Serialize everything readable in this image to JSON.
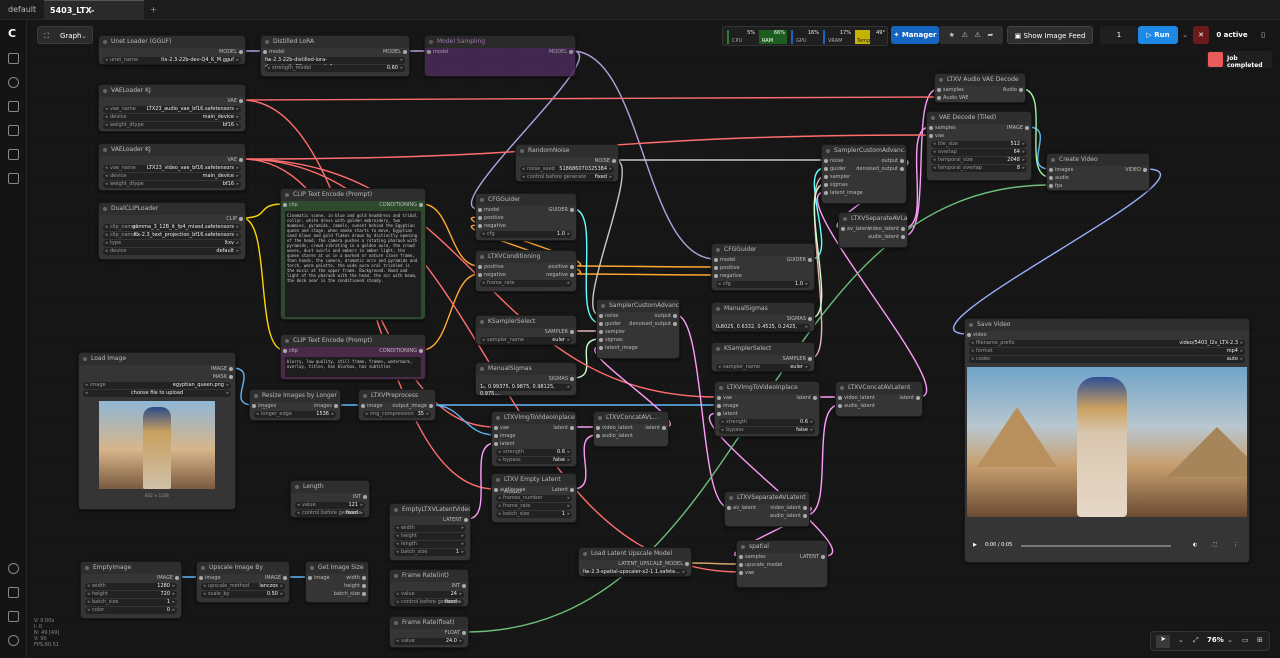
{
  "tabs": [
    {
      "label": "default"
    },
    {
      "label": "5403_LTX-2.3_I2V_...",
      "active": true
    }
  ],
  "toolbar": {
    "graph_label": "Graph",
    "cpu_label": "CPU",
    "cpu_val": "5%",
    "ram_label": "RAM",
    "ram_val": "66%",
    "gpu_label": "GPU",
    "gpu_val": "16%",
    "vram_label": "VRAM",
    "vram_val": "17%",
    "temp_label": "Temp",
    "temp_val": "49°",
    "manager": "Manager",
    "feed": "Show Image Feed",
    "queue_count": "1",
    "run": "Run",
    "active": "0 active",
    "job": "Job completed"
  },
  "zoom": "76%",
  "stats": [
    "V: 0.00x",
    "I: 0",
    "N: 49 [49]",
    "V: 90",
    "FPS:60.51"
  ],
  "nodes": {
    "unet": {
      "title": "Unet Loader (GGUF)",
      "badge": "GGUF",
      "out": "MODEL",
      "w": [
        [
          "unet_name",
          "ltx-2.3-22b-dev-Q4_K_M.gguf"
        ]
      ]
    },
    "lora": {
      "title": "Distilled LoRA",
      "in": "model",
      "out": "MODEL",
      "w": [
        [
          "",
          "ltx-2.3-22b-distilled-lora-dynamic_fro09_avg_rank_1..."
        ],
        [
          "strength_model",
          "0.60"
        ]
      ]
    },
    "bypass": {
      "title": "Model Sampling",
      "in": "model",
      "out": "MODEL"
    },
    "vae1": {
      "title": "VAELoader KJ",
      "badge": "comfyui-kjnodes",
      "out": "VAE",
      "w": [
        [
          "vae_name",
          "LTX23_audio_vae_bf16.safetensors"
        ],
        [
          "device",
          "main_device"
        ],
        [
          "weight_dtype",
          "bf16"
        ]
      ]
    },
    "vae2": {
      "title": "VAELoader KJ",
      "badge": "comfyui-kjnodes",
      "out": "VAE",
      "w": [
        [
          "vae_name",
          "LTX23_video_vae_bf16.safetensors"
        ],
        [
          "device",
          "main_device"
        ],
        [
          "weight_dtype",
          "bf16"
        ]
      ]
    },
    "clip": {
      "title": "DualCLIPLoader",
      "out": "CLIP",
      "w": [
        [
          "clip_name1",
          "gemma_3_12B_it_fp4_mixed.safetensors"
        ],
        [
          "clip_name2",
          "ltx-2.3_text_projection_bf16.safetensors"
        ],
        [
          "type",
          "ltxv"
        ],
        [
          "device",
          "default"
        ]
      ]
    },
    "pos": {
      "title": "CLIP Text Encode (Prompt)",
      "in": "clip",
      "out": "CONDITIONING",
      "text": "Cinematic scene, in blue and gold headdress and tribal collar, white dress with golden embroidery, two mummies, pyramids, camels, sunset behind the Egyptian queen and stage, when smoke starts to move, Egyptian sand blows and gold flakes drawn by distinctly opening of the head, the camera pushes a rotating pharaoh with pyramids, crowd vibrating in a golden aura, the crowd waves, dust swirls and embers in amber light, the queen stares at us in a marked or nature close frame, then hands, the camera, dramatic arcs and pyramids and torch, warm palette, the wide aura oral trickled is the music at the upper frame. Background. Hand and light of the pharaoh with the head, the air with beam, the deck near is the conditioned steady."
    },
    "neg": {
      "title": "CLIP Text Encode (Prompt)",
      "in": "clip",
      "out": "CONDITIONING",
      "text": "blurry, low quality, still frame, frames, watermark, overlay, titles, has blurbox, has subtitles"
    },
    "noise": {
      "title": "RandomNoise",
      "out": "NOISE",
      "w": [
        [
          "noise_seed",
          "518686070325384"
        ],
        [
          "control before generate",
          "fixed"
        ]
      ]
    },
    "cfg1": {
      "title": "CFGGuider",
      "ins": [
        "model",
        "positive",
        "negative"
      ],
      "out": "GUIDER",
      "w": [
        [
          "cfg",
          "1.0"
        ]
      ]
    },
    "ltxcond": {
      "title": "LTXVConditioning",
      "ins": [
        "positive",
        "negative"
      ],
      "outs": [
        "positive",
        "negative"
      ],
      "w": [
        [
          "frame_rate",
          ""
        ]
      ]
    },
    "ksel1": {
      "title": "KSamplerSelect",
      "out": "SAMPLER",
      "w": [
        [
          "sampler_name",
          "euler"
        ]
      ]
    },
    "msig1": {
      "title": "ManualSigmas",
      "out": "SIGMAS",
      "badge": "BETA",
      "w": [
        [
          "",
          "1., 0.99375, 0.9875, 0.98125, 0.975,..."
        ]
      ]
    },
    "sca1": {
      "title": "SamplerCustomAdvanc...",
      "ins": [
        "noise",
        "guider",
        "sampler",
        "sigmas",
        "latent_image"
      ],
      "outs": [
        "output",
        "denoised_output"
      ]
    },
    "sca2": {
      "title": "SamplerCustomAdvanc...",
      "ins": [
        "noise",
        "guider",
        "sampler",
        "sigmas",
        "latent_image"
      ],
      "outs": [
        "output",
        "denoised_output"
      ]
    },
    "cfg2": {
      "title": "CFGGuider",
      "ins": [
        "model",
        "positive",
        "negative"
      ],
      "out": "GUIDER",
      "w": [
        [
          "cfg",
          "1.0"
        ]
      ]
    },
    "msig2": {
      "title": "ManualSigmas",
      "out": "SIGMAS",
      "badge": "BETA",
      "w": [
        [
          "",
          "0.8025, 0.6332, 0.4525, 0.2425, 0.0"
        ]
      ]
    },
    "ksel2": {
      "title": "KSamplerSelect",
      "out": "SAMPLER",
      "w": [
        [
          "sampler_name",
          "euler"
        ]
      ]
    },
    "sep1": {
      "title": "LTXVSeparateAVLatent",
      "ins": [
        "av_latent"
      ],
      "outs": [
        "video_latent",
        "audio_latent"
      ]
    },
    "sep2": {
      "title": "LTXVSeparateAVLatent",
      "ins": [
        "av_latent"
      ],
      "outs": [
        "video_latent",
        "audio_latent"
      ]
    },
    "aud": {
      "title": "LTXV Audio VAE Decode",
      "ins": [
        "samples",
        "Audio VAE"
      ],
      "out": "Audio",
      "badge": "BETA"
    },
    "vdec": {
      "title": "VAE Decode (Tiled)",
      "ins": [
        "samples",
        "vae"
      ],
      "out": "IMAGE",
      "w": [
        [
          "tile_size",
          "512"
        ],
        [
          "overlap",
          "64"
        ],
        [
          "temporal_size",
          "2048"
        ],
        [
          "temporal_overlap",
          "8"
        ]
      ]
    },
    "cvid": {
      "title": "Create Video",
      "ins": [
        "images",
        "audio",
        "fps"
      ],
      "out": "VIDEO"
    },
    "save": {
      "title": "Save Video",
      "ins": [
        "video"
      ],
      "w": [
        [
          "filename_prefix",
          "video/5403_I2v_LTX-2.3"
        ],
        [
          "format",
          "mp4"
        ],
        [
          "codec",
          "auto"
        ]
      ],
      "time": "0:00 / 0:05"
    },
    "load": {
      "title": "Load Image",
      "outs": [
        "IMAGE",
        "MASK"
      ],
      "w": [
        [
          "image",
          "egyptian_queen.png"
        ]
      ],
      "btn": "choose file to upload",
      "dim": "832 × 1248"
    },
    "resize": {
      "title": "Resize Images by Longer ...",
      "ins": [
        "images"
      ],
      "out": "images",
      "badge": "BETA",
      "w": [
        [
          "longer_edge",
          "1536"
        ]
      ]
    },
    "prep": {
      "title": "LTXVPreprocess",
      "ins": [
        "image"
      ],
      "out": "output_image",
      "w": [
        [
          "img_compression",
          "35"
        ]
      ]
    },
    "ittv1": {
      "title": "LTXVImgToVideoInplace",
      "ins": [
        "vae",
        "image",
        "latent"
      ],
      "out": "latent",
      "w": [
        [
          "strength",
          "0.6"
        ],
        [
          "bypass",
          "false"
        ]
      ]
    },
    "concat1": {
      "title": "LTXVConcatAVL...",
      "ins": [
        "video_latent",
        "audio_latent"
      ],
      "out": "latent"
    },
    "empaudio": {
      "title": "LTXV Empty Latent Audio",
      "ins": [
        "audio_vae"
      ],
      "out": "Latent",
      "w": [
        [
          "frames_number",
          ""
        ],
        [
          "frame_rate",
          ""
        ],
        [
          "batch_size",
          "1"
        ]
      ]
    },
    "ittv2": {
      "title": "LTXVImgToVideoInplace",
      "ins": [
        "vae",
        "image",
        "latent"
      ],
      "out": "latent",
      "w": [
        [
          "strength",
          "0.6"
        ],
        [
          "bypass",
          "false"
        ]
      ]
    },
    "concat2": {
      "title": "LTXVConcatAVLatent",
      "ins": [
        "video_latent",
        "audio_latent"
      ],
      "out": "latent"
    },
    "length": {
      "title": "Length",
      "out": "INT",
      "w": [
        [
          "value",
          "121"
        ],
        [
          "control before generate",
          "fixed"
        ]
      ]
    },
    "emptylat": {
      "title": "EmptyLTXVLatentVideo",
      "out": "LATENT",
      "w": [
        [
          "width",
          ""
        ],
        [
          "height",
          ""
        ],
        [
          "length",
          ""
        ],
        [
          "batch_size",
          "1"
        ]
      ]
    },
    "fr1": {
      "title": "Frame Rate(int)",
      "out": "INT",
      "w": [
        [
          "value",
          "24"
        ],
        [
          "control before generate",
          "fixed"
        ]
      ]
    },
    "fr2": {
      "title": "Frame Rate(float)",
      "out": "FLOAT",
      "w": [
        [
          "value",
          "24.0"
        ]
      ]
    },
    "upsmodel": {
      "title": "Load Latent Upscale Model",
      "out": "LATENT_UPSCALE_MODEL",
      "w": [
        [
          "",
          "ltx-2.3-spatial-upscaler-x2-1.1.safete..."
        ]
      ]
    },
    "spatial": {
      "title": "spatial",
      "ins": [
        "samples",
        "upscale_model",
        "vae"
      ],
      "out": "LATENT",
      "badge": "BETA"
    },
    "emptyimg": {
      "title": "EmptyImage",
      "out": "IMAGE",
      "w": [
        [
          "width",
          "1280"
        ],
        [
          "height",
          "720"
        ],
        [
          "batch_size",
          "1"
        ],
        [
          "color",
          "0"
        ]
      ]
    },
    "upscale": {
      "title": "Upscale Image By",
      "ins": [
        "image"
      ],
      "out": "IMAGE",
      "w": [
        [
          "upscale_method",
          "lanczos"
        ],
        [
          "scale_by",
          "0.50"
        ]
      ]
    },
    "getsize": {
      "title": "Get Image Size",
      "ins": [
        "image"
      ],
      "outs": [
        "width",
        "height",
        "batch_size"
      ]
    }
  },
  "colors": {
    "model": "#b39ddb",
    "vae": "#ff6e6e",
    "clip": "#ffd500",
    "cond": "#ffa931",
    "latent": "#ff9cf9",
    "image": "#64b5f6",
    "int": "#6dbf7b",
    "noise": "#c8c8c8",
    "guider": "#66ffff",
    "sampler": "#ecb4b4",
    "sigmas": "#cdffcd",
    "audio": "#9af4a8",
    "video": "#9ab0ff"
  }
}
